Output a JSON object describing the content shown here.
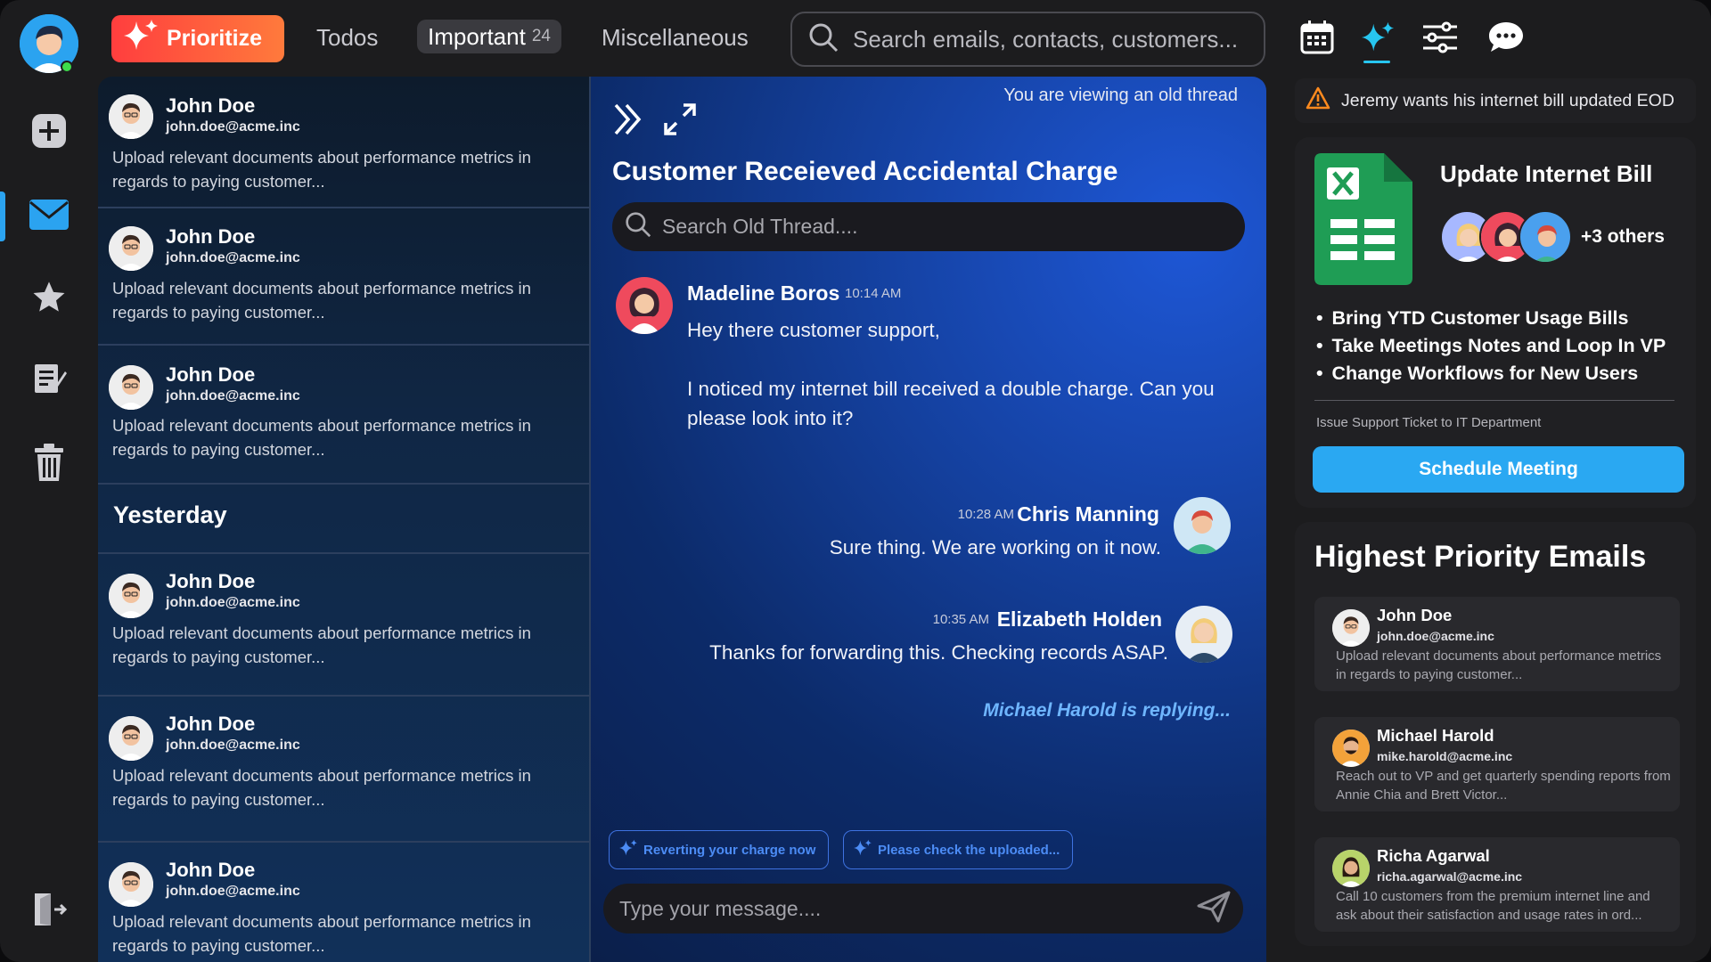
{
  "topbar": {
    "prioritize_label": "Prioritize",
    "tabs": [
      {
        "label": "Todos"
      },
      {
        "label": "Important",
        "count": "24"
      },
      {
        "label": "Miscellaneous"
      }
    ],
    "search_placeholder": "Search emails, contacts, customers..."
  },
  "rail": {
    "items": [
      "add-icon",
      "mail-icon",
      "star-icon",
      "notes-icon",
      "trash-icon",
      "logout-icon"
    ],
    "accent": "#2ba3f0"
  },
  "list": {
    "items": [
      {
        "name": "John Doe",
        "address": "john.doe@acme.inc",
        "preview": "Upload relevant documents about performance metrics in regards to paying customer..."
      },
      {
        "name": "John Doe",
        "address": "john.doe@acme.inc",
        "preview": "Upload relevant documents about performance metrics in regards to paying customer..."
      },
      {
        "name": "John Doe",
        "address": "john.doe@acme.inc",
        "preview": "Upload relevant documents about performance metrics in regards to paying customer..."
      },
      {
        "name": "John Doe",
        "address": "john.doe@acme.inc",
        "preview": "Upload relevant documents about performance metrics in regards to paying customer..."
      },
      {
        "name": "John Doe",
        "address": "john.doe@acme.inc",
        "preview": "Upload relevant documents about performance metrics in regards to paying customer..."
      },
      {
        "name": "John Doe",
        "address": "john.doe@acme.inc",
        "preview": "Upload relevant documents about performance metrics in regards to paying customer..."
      }
    ],
    "day_label": "Yesterday"
  },
  "thread": {
    "notice": "You are viewing an old thread",
    "title": "Customer Receieved Accidental Charge",
    "search_placeholder": "Search Old Thread....",
    "messages": [
      {
        "name": "Madeline Boros",
        "time": "10:14 AM",
        "text1": "Hey there customer support,",
        "text2": "I noticed my internet bill received a double charge. Can you please look into it?"
      },
      {
        "name": "Chris Manning",
        "time": "10:28 AM",
        "text1": "Sure thing. We are working on it now."
      },
      {
        "name": "Elizabeth Holden",
        "time": "10:35 AM",
        "text1": "Thanks for forwarding this. Checking records ASAP."
      }
    ],
    "typing": "Michael Harold is replying...",
    "suggestions": [
      "Reverting your charge now",
      "Please check the uploaded..."
    ],
    "composer_placeholder": "Type your message...."
  },
  "alert": {
    "text": "Jeremy wants his internet bill updated EOD",
    "color": "#ff8a1e"
  },
  "card": {
    "title": "Update Internet Bill",
    "others": "+3 others",
    "bullets": [
      "Bring YTD Customer Usage Bills",
      "Take Meetings Notes and Loop In VP",
      "Change Workflows for New Users"
    ],
    "subtext": "Issue Support Ticket to IT Department",
    "button": "Schedule Meeting"
  },
  "priority": {
    "title": "Highest Priority Emails",
    "items": [
      {
        "name": "John Doe",
        "address": "john.doe@acme.inc",
        "text": "Upload relevant documents about performance metrics in regards to paying customer..."
      },
      {
        "name": "Michael Harold",
        "address": "mike.harold@acme.inc",
        "text": "Reach out to VP and get quarterly spending reports from Annie Chia and Brett Victor..."
      },
      {
        "name": "Richa Agarwal",
        "address": "richa.agarwal@acme.inc",
        "text": "Call 10 customers from the premium internet line and ask about their satisfaction and usage rates in ord..."
      }
    ]
  }
}
